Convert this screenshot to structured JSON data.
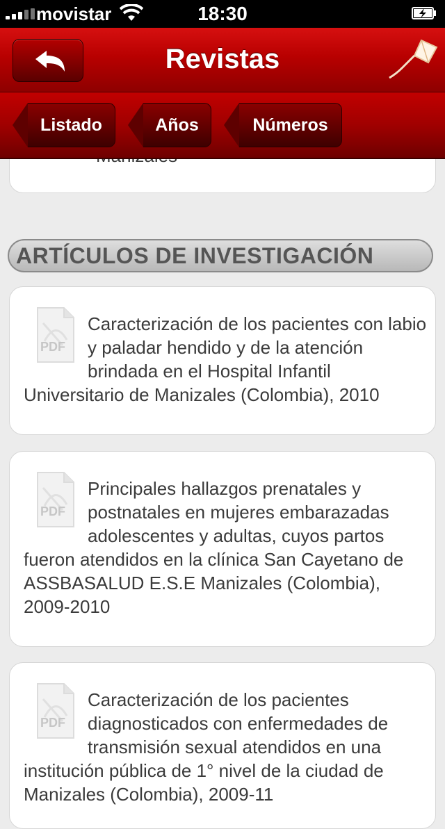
{
  "status_bar": {
    "carrier": "movistar",
    "time": "18:30"
  },
  "nav": {
    "title": "Revistas",
    "back_icon": "back-arrow-icon",
    "logo_icon": "kite-logo-icon"
  },
  "breadcrumbs": [
    "Listado",
    "Años",
    "Números"
  ],
  "partial_card_text": "Manizales",
  "section": {
    "title": "ARTÍCULOS DE INVESTIGACIÓN"
  },
  "articles": [
    {
      "icon": "pdf-icon",
      "title": "Caracterización de los pacientes con labio y paladar hendido y de la atención brindada en el Hospital Infantil Universitario de Manizales (Colombia), 2010"
    },
    {
      "icon": "pdf-icon",
      "title": "Principales hallazgos prenatales y postnatales en mujeres embarazadas adolescentes y adultas, cuyos partos fueron atendidos en la clínica San Cayetano de ASSBASALUD E.S.E Manizales (Colombia), 2009-2010"
    },
    {
      "icon": "pdf-icon",
      "title": "Caracterización de los pacientes diagnosticados con enfermedades de transmisión sexual atendidos en una institución pública de 1° nivel de la ciudad de Manizales (Colombia), 2009-11"
    }
  ],
  "colors": {
    "nav_red": "#b80000",
    "background": "#ececec",
    "text": "#3b3b3b"
  }
}
